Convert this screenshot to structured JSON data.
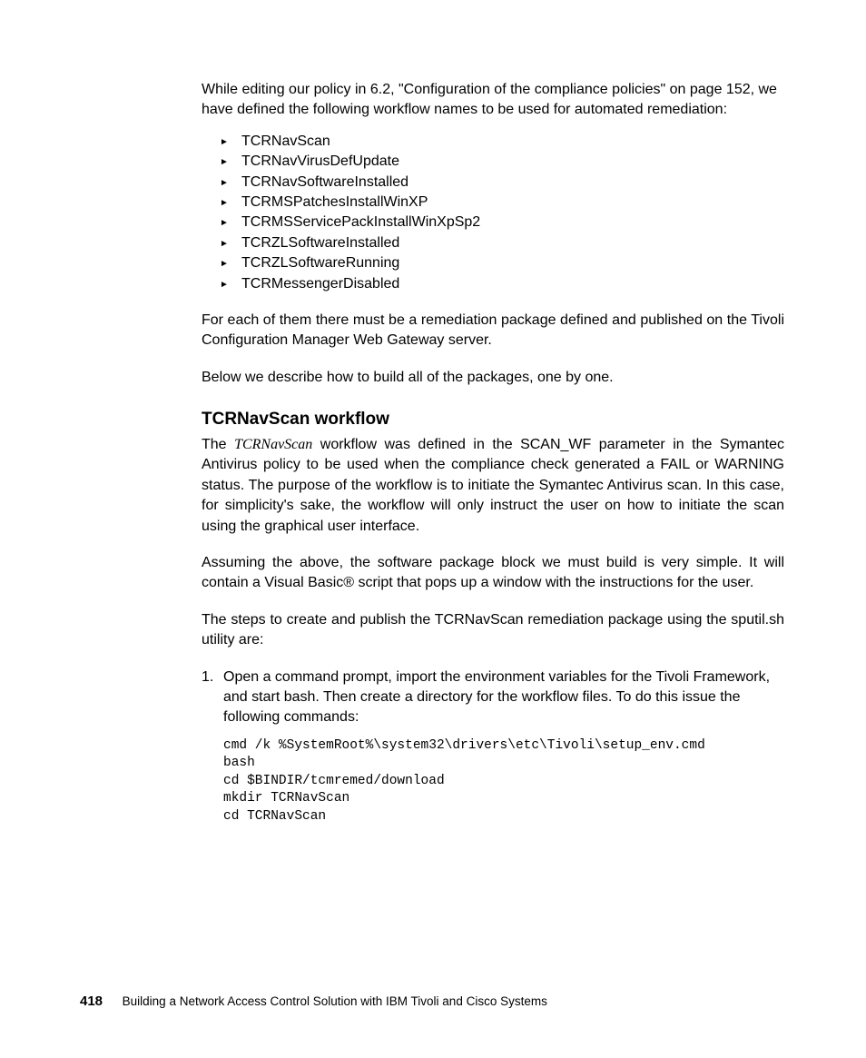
{
  "intro": "While editing our policy in 6.2, \"Configuration of the compliance policies\" on page 152, we have defined the following workflow names to be used for automated remediation:",
  "workflows": [
    "TCRNavScan",
    "TCRNavVirusDefUpdate",
    "TCRNavSoftwareInstalled",
    "TCRMSPatchesInstallWinXP",
    "TCRMSServicePackInstallWinXpSp2",
    "TCRZLSoftwareInstalled",
    "TCRZLSoftwareRunning",
    "TCRMessengerDisabled"
  ],
  "para_after_list": "For each of them there must be a remediation package defined and published on the Tivoli Configuration Manager Web Gateway server.",
  "para_below": "Below we describe how to build all of the packages, one by one.",
  "section_heading": "TCRNavScan workflow",
  "section_para_prefix": "The ",
  "section_para_italic": "TCRNavScan",
  "section_para_rest": " workflow was defined in the SCAN_WF parameter in the Symantec Antivirus policy to be used when the compliance check generated a FAIL or WARNING status. The purpose of the workflow is to initiate the Symantec Antivirus scan. In this case, for simplicity's sake, the workflow will only instruct the user on how to initiate the scan using the graphical user interface.",
  "section_para2": "Assuming the above, the software package block we must build is very simple. It will contain a Visual Basic® script that pops up a window with the instructions for the user.",
  "section_para3": "The steps to create and publish the TCRNavScan remediation package using the sputil.sh utility are:",
  "step1_num": "1.",
  "step1_text": "Open a command prompt, import the environment variables for the Tivoli Framework, and start bash. Then create a directory for the workflow files. To do this issue the following commands:",
  "code_lines": [
    "cmd /k %SystemRoot%\\system32\\drivers\\etc\\Tivoli\\setup_env.cmd",
    "bash",
    "cd $BINDIR/tcmremed/download",
    "mkdir TCRNavScan",
    "cd TCRNavScan"
  ],
  "footer": {
    "page_number": "418",
    "title": "Building a Network Access Control Solution with IBM Tivoli and Cisco Systems"
  }
}
